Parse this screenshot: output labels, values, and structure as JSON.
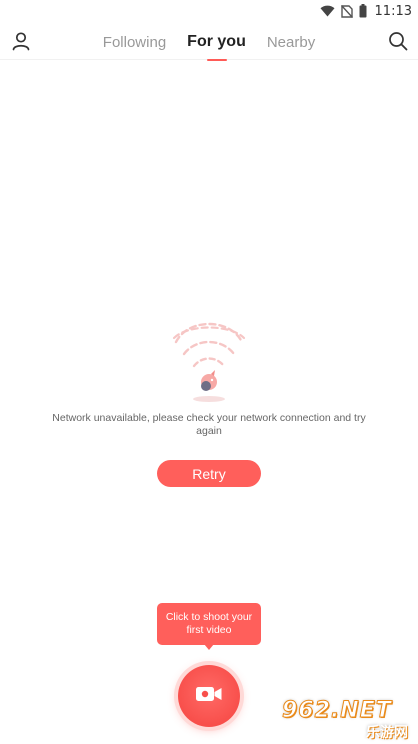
{
  "status_bar": {
    "time": "11:13",
    "icons": [
      "wifi-icon",
      "no-sim-icon",
      "battery-icon"
    ]
  },
  "header": {
    "tabs": [
      {
        "label": "Following",
        "active": false
      },
      {
        "label": "For you",
        "active": true
      },
      {
        "label": "Nearby",
        "active": false
      }
    ],
    "left_icon": "person-icon",
    "right_icon": "search-icon"
  },
  "empty_state": {
    "illustration": "broken-signal-icon",
    "message": "Network unavailable, please check your network connection and try again",
    "retry_label": "Retry"
  },
  "shoot": {
    "tooltip": "Click to shoot your first video",
    "icon": "video-camera-icon"
  },
  "watermark": {
    "text": "962.NET",
    "subtext": "乐游网"
  },
  "colors": {
    "accent": "#ff5f5b",
    "tab_active": "#222222",
    "tab_inactive": "#999999",
    "message_text": "#666666"
  }
}
